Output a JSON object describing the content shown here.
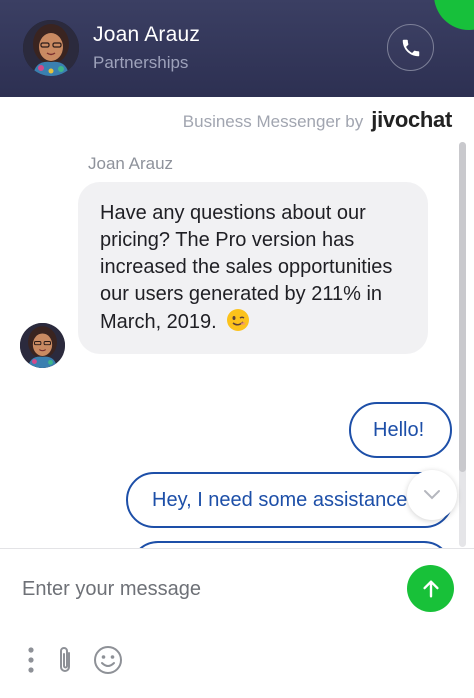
{
  "header": {
    "agent_name": "Joan Arauz",
    "agent_department": "Partnerships",
    "call_icon": "phone-icon",
    "background": "#2f3254",
    "status_dot_color": "#17c03b"
  },
  "branding": {
    "text": "Business Messenger by",
    "logo": "jivochat"
  },
  "conversation": {
    "sender_name": "Joan Arauz",
    "incoming_message": "Have any questions about our pricing? The Pro version has increased the sales opportunities our users generated by 211% in March, 2019.",
    "incoming_emoji": "winking-face-icon",
    "outgoing_messages": [
      {
        "text": "Hello!"
      },
      {
        "text": "Hey, I need some assistance"
      },
      {
        "text": ""
      }
    ],
    "accent_color": "#1d4fa8"
  },
  "composer": {
    "placeholder": "Enter your message",
    "value": "",
    "send_icon": "arrow-up-icon",
    "send_color": "#18c139",
    "tools": [
      "more-vertical-icon",
      "paperclip-icon",
      "smiley-icon"
    ]
  }
}
